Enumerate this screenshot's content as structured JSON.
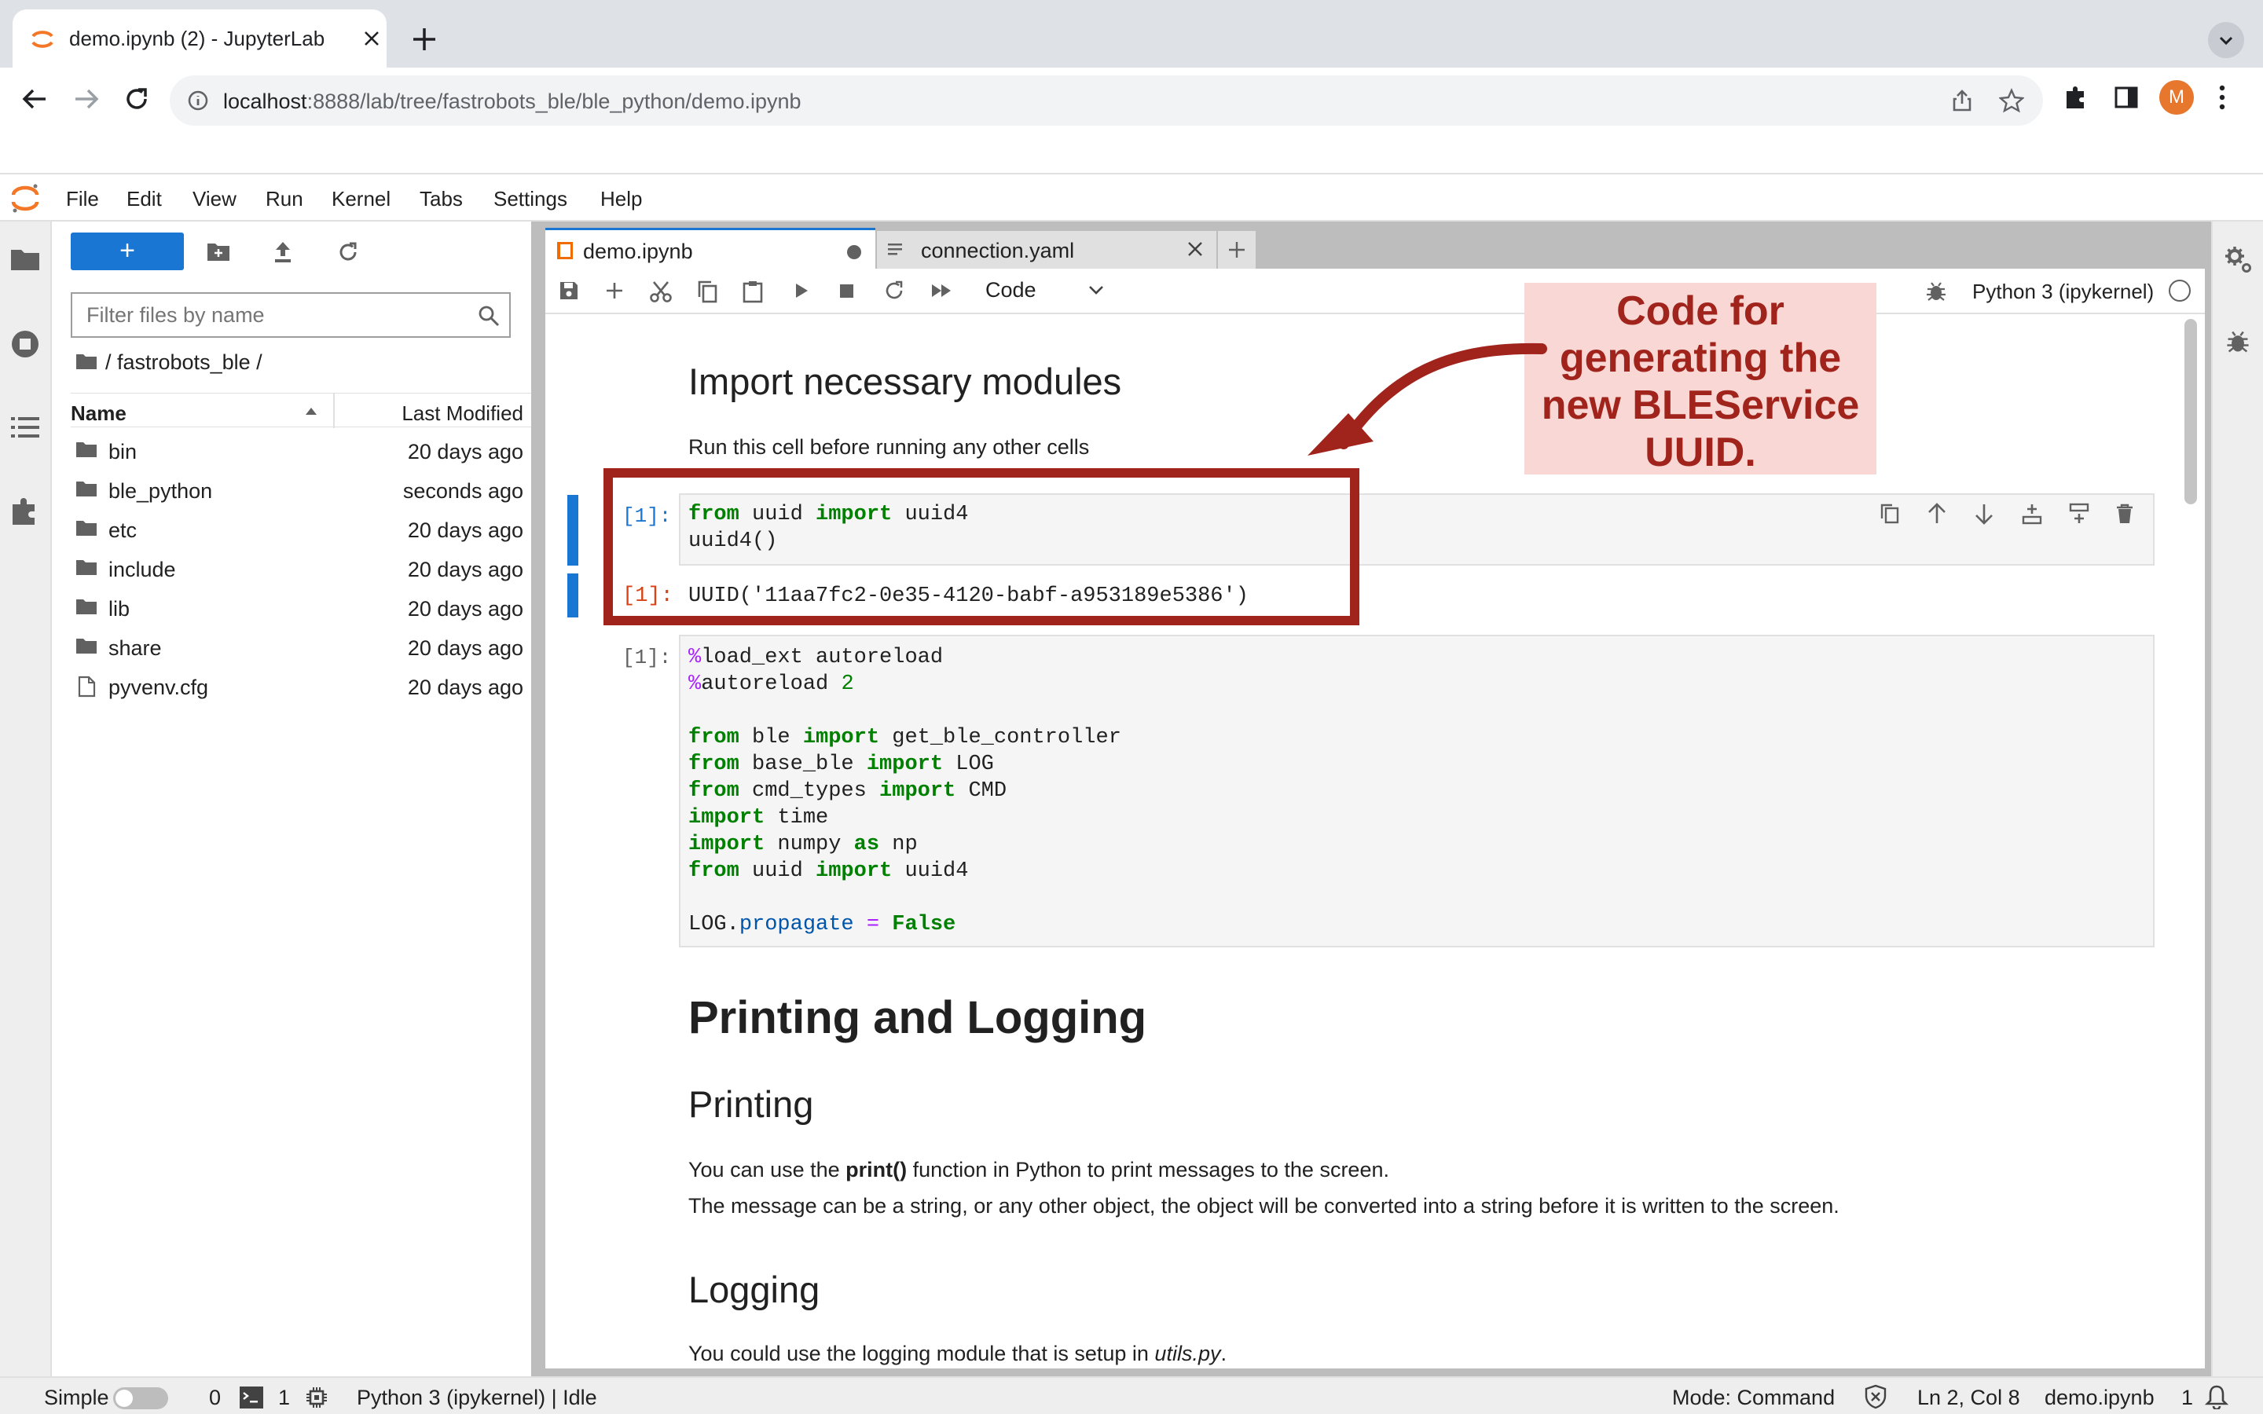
{
  "browser": {
    "tab_title": "demo.ipynb (2) - JupyterLab",
    "url_host": "localhost",
    "url_rest": ":8888/lab/tree/fastrobots_ble/ble_python/demo.ipynb",
    "profile_initial": "M",
    "accent": "#e8772e"
  },
  "menubar": {
    "items": [
      "File",
      "Edit",
      "View",
      "Run",
      "Kernel",
      "Tabs",
      "Settings",
      "Help"
    ]
  },
  "filebrowser": {
    "new_label": "+",
    "filter_placeholder": "Filter files by name",
    "breadcrumb": "/ fastrobots_ble /",
    "col_name": "Name",
    "col_modified": "Last Modified",
    "files": [
      {
        "name": "bin",
        "type": "folder",
        "modified": "20 days ago"
      },
      {
        "name": "ble_python",
        "type": "folder",
        "modified": "seconds ago"
      },
      {
        "name": "etc",
        "type": "folder",
        "modified": "20 days ago"
      },
      {
        "name": "include",
        "type": "folder",
        "modified": "20 days ago"
      },
      {
        "name": "lib",
        "type": "folder",
        "modified": "20 days ago"
      },
      {
        "name": "share",
        "type": "folder",
        "modified": "20 days ago"
      },
      {
        "name": "pyvenv.cfg",
        "type": "file",
        "modified": "20 days ago"
      }
    ]
  },
  "tabs": [
    {
      "label": "demo.ipynb",
      "active": true
    },
    {
      "label": "connection.yaml",
      "active": false
    }
  ],
  "toolbar": {
    "cell_type": "Code",
    "kernel": "Python 3 (ipykernel)"
  },
  "notebook": {
    "h_import": "Import necessary modules",
    "p_import": "Run this cell before running any other cells",
    "cell1_prompt": "[1]:",
    "cell1_out": "UUID('11aa7fc2-0e35-4120-babf-a953189e5386')",
    "cell2_prompt": "[1]:",
    "h_printlog": "Printing and Logging",
    "h_print": "Printing",
    "p_print_a": "You can use the ",
    "p_print_b": "print()",
    "p_print_c": " function in Python to print messages to the screen.",
    "p_print2": "The message can be a string, or any other object, the object will be converted into a string before it is written to the screen.",
    "h_logging": "Logging",
    "p_logging_a": "You could use the logging module that is setup in ",
    "p_logging_b": "utils.py",
    "p_logging_c": "."
  },
  "annotation": {
    "callout": "Code for generating the new BLEService UUID.",
    "color": "#a0241c"
  },
  "statusbar": {
    "mode_label": "Simple",
    "terminals": "0",
    "kernels": "1",
    "kernel_status": "Python 3 (ipykernel) | Idle",
    "mode": "Mode: Command",
    "cursor": "Ln 2, Col 8",
    "file": "demo.ipynb",
    "notifications": "1"
  }
}
